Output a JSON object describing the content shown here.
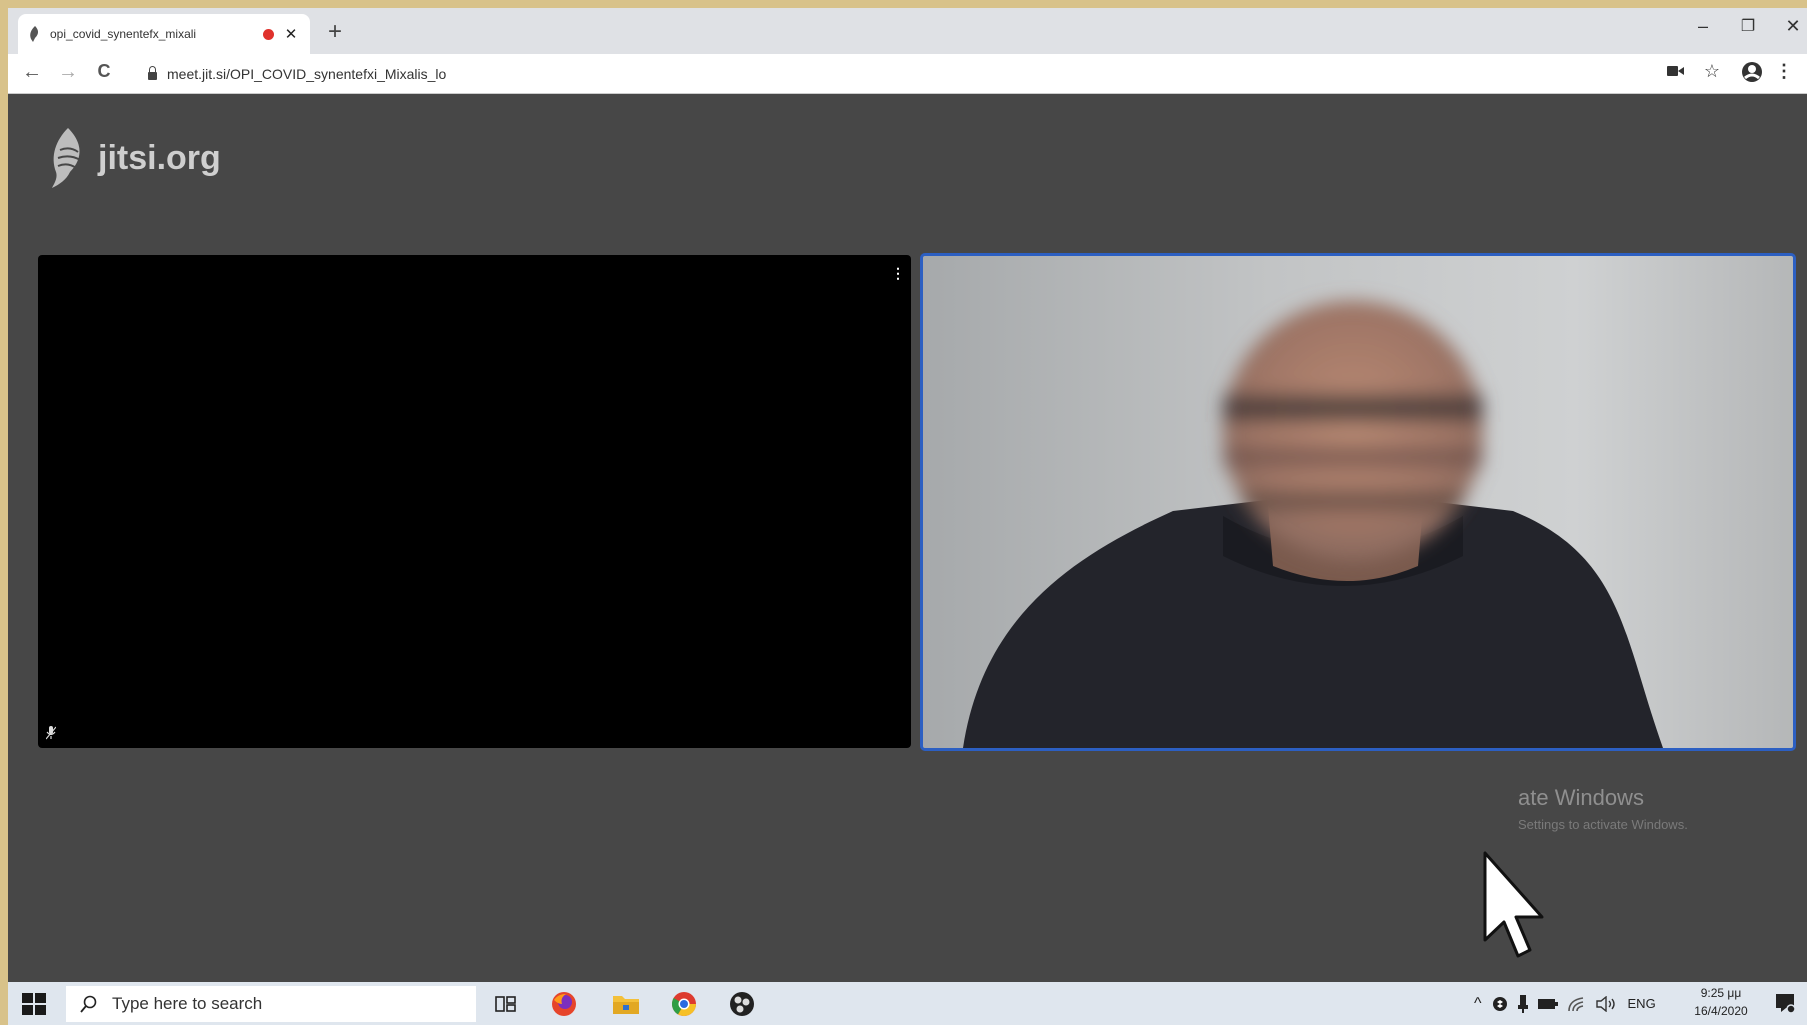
{
  "browser": {
    "tab_title": "opi_covid_synentefx_mixali",
    "tab_close": "✕",
    "new_tab": "+",
    "window_controls": {
      "minimize": "–",
      "maximize": "❐",
      "close": "✕"
    },
    "nav": {
      "back": "←",
      "forward": "→",
      "reload": "C"
    },
    "url": "meet.jit.si/OPI_COVID_synentefxi_Mixalis_lo",
    "toolbar": {
      "star": "☆",
      "menu": "⋮"
    }
  },
  "jitsi": {
    "logo_text": "jitsi.org",
    "remote_tile": {
      "menu_label": "⋮"
    }
  },
  "watermark": {
    "title": "ate Windows",
    "subtitle": "Settings to activate Windows."
  },
  "taskbar": {
    "search_placeholder": "Type here to search",
    "tray": {
      "language": "ENG"
    },
    "clock": {
      "time": "9:25 μμ",
      "date": "16/4/2020"
    }
  },
  "colors": {
    "accent": "#2c5fc2",
    "record": "#e0312c",
    "page_bg": "#474747"
  }
}
